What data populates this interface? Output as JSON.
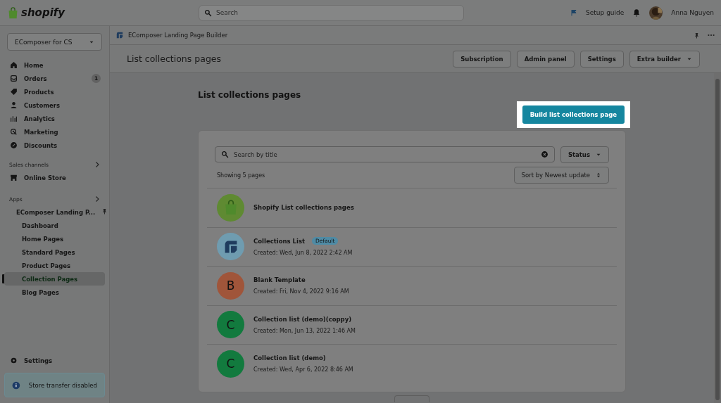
{
  "topbar": {
    "brand": "shopify",
    "search": {
      "placeholder": "Search"
    },
    "setup_guide": "Setup guide",
    "user": "Anna Nguyen"
  },
  "sidebar": {
    "store": "EComposer for CS",
    "items": [
      {
        "label": "Home"
      },
      {
        "label": "Orders",
        "badge": "1"
      },
      {
        "label": "Products"
      },
      {
        "label": "Customers"
      },
      {
        "label": "Analytics"
      },
      {
        "label": "Marketing"
      },
      {
        "label": "Discounts"
      }
    ],
    "sales_channels": {
      "heading": "Sales channels",
      "items": [
        {
          "label": "Online Store"
        }
      ]
    },
    "apps": {
      "heading": "Apps",
      "app": "EComposer Landing P...",
      "children": [
        {
          "label": "Dashboard",
          "selected": false
        },
        {
          "label": "Home Pages",
          "selected": false
        },
        {
          "label": "Standard Pages",
          "selected": false
        },
        {
          "label": "Product Pages",
          "selected": false
        },
        {
          "label": "Collection Pages",
          "selected": true
        },
        {
          "label": "Blog Pages",
          "selected": false
        }
      ]
    },
    "settings": "Settings",
    "notice": "Store transfer disabled"
  },
  "app_bar": {
    "title": "EComposer Landing Page Builder"
  },
  "title_bar": {
    "title": "List collections pages",
    "buttons": [
      {
        "label": "Subscription",
        "dropdown": false
      },
      {
        "label": "Admin panel",
        "dropdown": false
      },
      {
        "label": "Settings",
        "dropdown": false
      },
      {
        "label": "Extra builder",
        "dropdown": true
      }
    ]
  },
  "content": {
    "heading": "List collections pages",
    "primary_button": {
      "label": "Build list collections page",
      "highlighted": true
    },
    "search": {
      "placeholder": "Search by title"
    },
    "status_filter": "Status",
    "count": "Showing 5 pages",
    "sort": "Sort by Newest update",
    "rows": [
      {
        "kind": "shopify",
        "title": "Shopify List collections pages"
      },
      {
        "kind": "ecomposer",
        "title": "Collections List",
        "badge": "Default",
        "created": "Created: Wed, Jun 8, 2022 2:42 AM"
      },
      {
        "kind": "letter",
        "letter": "B",
        "color": "#a0553a",
        "title": "Blank Template",
        "created": "Created: Fri, Nov 4, 2022 9:16 AM"
      },
      {
        "kind": "letter",
        "letter": "C",
        "color": "#127a3e",
        "title": "Collection list (demo)(coppy)",
        "created": "Created: Mon, Jun 13, 2022 1:46 AM"
      },
      {
        "kind": "letter",
        "letter": "C",
        "color": "#127a3e",
        "title": "Collection list (demo)",
        "created": "Created: Wed, Apr 6, 2022 8:46 AM"
      }
    ]
  }
}
